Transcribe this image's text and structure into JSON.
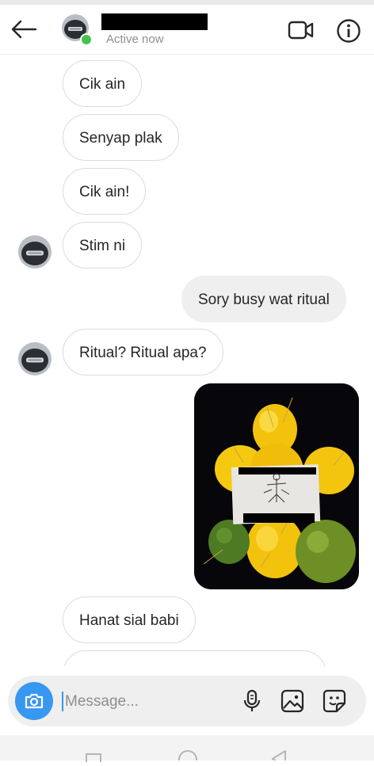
{
  "header": {
    "status": "Active now",
    "online_color": "#46c34b"
  },
  "messages": [
    {
      "from": "them",
      "text": "Cik ain"
    },
    {
      "from": "them",
      "text": "Senyap plak"
    },
    {
      "from": "them",
      "text": "Cik ain!"
    },
    {
      "from": "them",
      "text": "Stim ni"
    },
    {
      "from": "me",
      "text": "Sory busy wat ritual"
    },
    {
      "from": "them",
      "text": "Ritual? Ritual apa?"
    },
    {
      "from": "me",
      "type": "photo"
    },
    {
      "from": "them",
      "text": "Hanat sial babi"
    }
  ],
  "composer": {
    "placeholder": "Message..."
  },
  "colors": {
    "accent": "#3897f0",
    "incoming_border": "#dbdbdb",
    "outgoing_bg": "#efefef"
  },
  "icons": [
    "back-arrow-icon",
    "video-call-icon",
    "info-icon",
    "camera-icon",
    "microphone-icon",
    "gallery-icon",
    "sticker-icon"
  ]
}
